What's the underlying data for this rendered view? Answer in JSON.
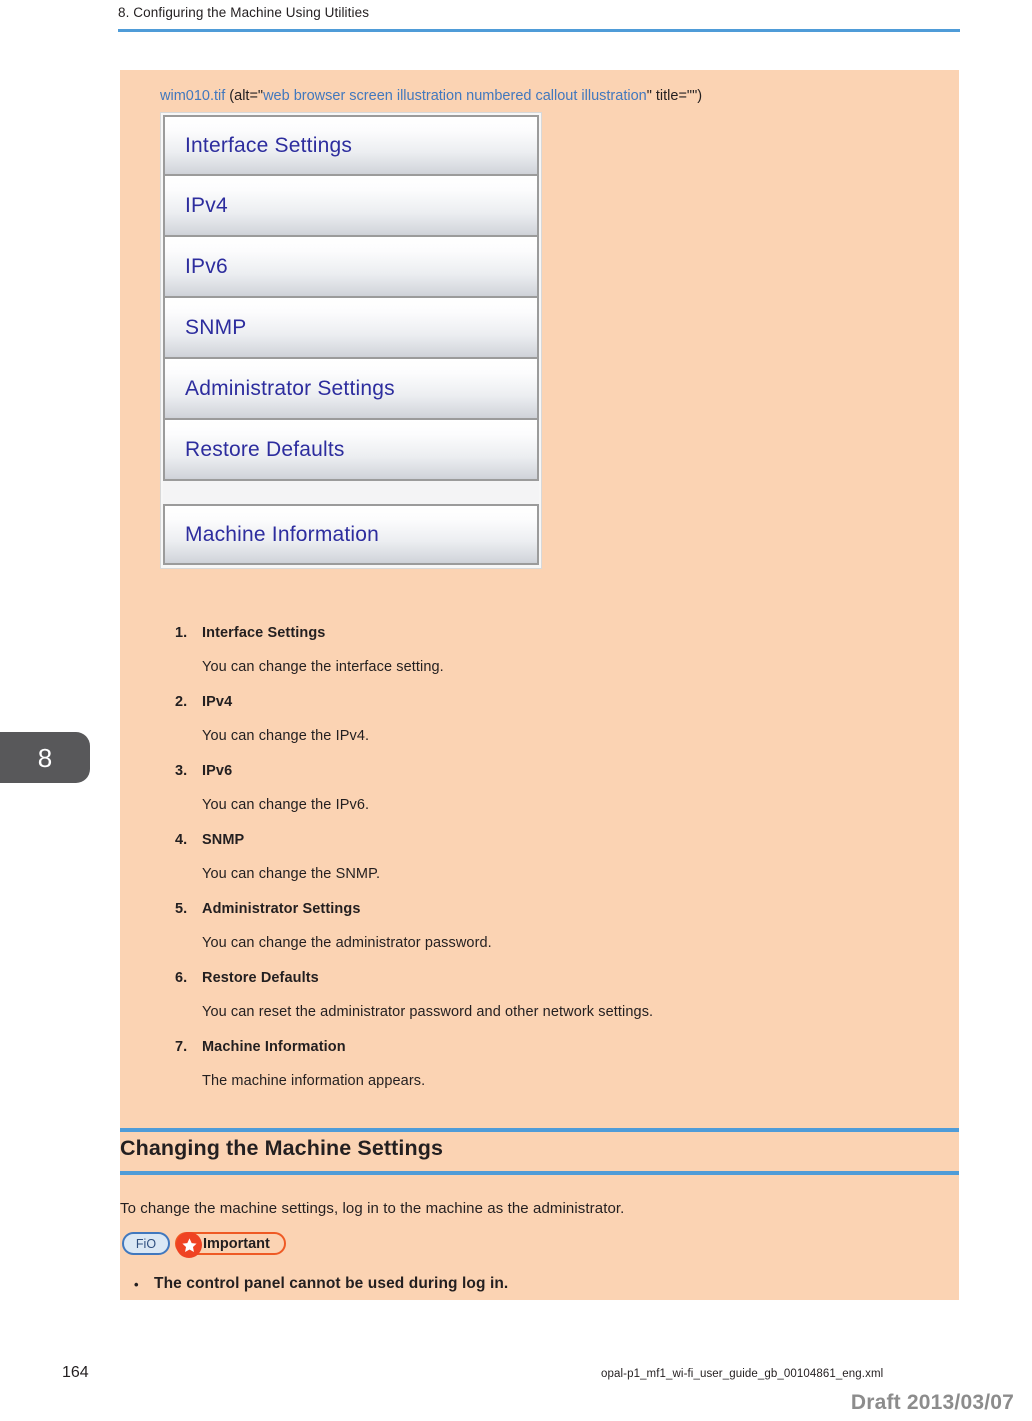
{
  "header": {
    "chapter_title": "8. Configuring the Machine Using Utilities",
    "rule_color": "#4f9cd8"
  },
  "chapter_tab": {
    "number": "8",
    "bg_color": "#58585a"
  },
  "figure": {
    "filename": "wim010.tif",
    "attr_prefix": " (alt=\"",
    "alt_text": "web browser screen illustration numbered callout illustration",
    "attr_suffix": "\" title=\"\")",
    "link_color": "#4178be",
    "buttons": [
      {
        "label": "Interface Settings",
        "detached": false
      },
      {
        "label": "IPv4",
        "detached": false
      },
      {
        "label": "IPv6",
        "detached": false
      },
      {
        "label": "SNMP",
        "detached": false
      },
      {
        "label": "Administrator Settings",
        "detached": false
      },
      {
        "label": "Restore Defaults",
        "detached": false
      },
      {
        "label": "Machine Information",
        "detached": true
      }
    ],
    "button_text_color": "#2d2d9e"
  },
  "callouts": [
    {
      "num": "1.",
      "title": "Interface Settings",
      "desc": "You can change the interface setting."
    },
    {
      "num": "2.",
      "title": "IPv4",
      "desc": "You can change the IPv4."
    },
    {
      "num": "3.",
      "title": "IPv6",
      "desc": "You can change the IPv6."
    },
    {
      "num": "4.",
      "title": "SNMP",
      "desc": "You can change the SNMP."
    },
    {
      "num": "5.",
      "title": "Administrator Settings",
      "desc": "You can change the administrator password."
    },
    {
      "num": "6.",
      "title": "Restore Defaults",
      "desc": "You can reset the administrator password and other network settings."
    },
    {
      "num": "7.",
      "title": "Machine Information",
      "desc": "The machine information appears."
    }
  ],
  "section": {
    "heading": "Changing the Machine Settings",
    "paragraph": "To change the machine settings, log in to the machine as the administrator."
  },
  "important_note": {
    "fio_label": "FiO",
    "important_label": "Important",
    "star_icon": "star-icon",
    "fio_border_color": "#4178be",
    "important_border_color": "#ef5a24",
    "star_bg_color": "#ef4323",
    "bullet_glyph": "•",
    "bullet_text": "The control panel cannot be used during log in."
  },
  "footer": {
    "page_number": "164",
    "source_file": "opal-p1_mf1_wi-fi_user_guide_gb_00104861_eng.xml",
    "draft_label": "Draft 2013/03/07"
  }
}
